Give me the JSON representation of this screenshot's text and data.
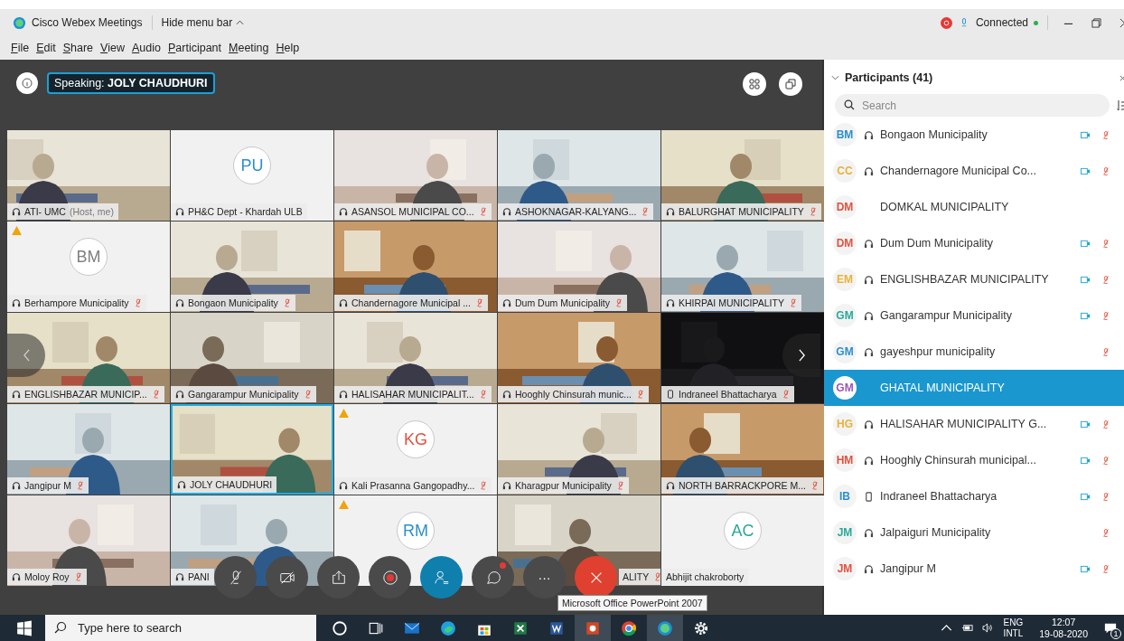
{
  "window": {
    "app_title": "Cisco Webex Meetings",
    "menu_toggle": "Hide menu bar",
    "status": "Connected"
  },
  "menu": [
    "File",
    "Edit",
    "Share",
    "View",
    "Audio",
    "Participant",
    "Meeting",
    "Help"
  ],
  "speaking": {
    "label": "Speaking:",
    "name": "JOLY CHAUDHURI"
  },
  "tiles": [
    {
      "kind": "video",
      "name": "ATI- UMC",
      "note": "(Host, me)",
      "audio": {
        "kind": "headset"
      },
      "muted": false,
      "warning": false,
      "active": false,
      "covered": false
    },
    {
      "kind": "avatar",
      "initials": "PU",
      "color": "#2a8fd0",
      "name": "PH&C Dept - Khardah ULB",
      "audio": {
        "kind": "headset"
      },
      "muted": false,
      "warning": false,
      "active": false,
      "covered": false
    },
    {
      "kind": "video",
      "name": "ASANSOL MUNICIPAL CO...",
      "audio": {
        "kind": "headset"
      },
      "muted": true,
      "warning": false,
      "active": false,
      "covered": false
    },
    {
      "kind": "video",
      "name": "ASHOKNAGAR-KALYANG...",
      "audio": {
        "kind": "headset"
      },
      "muted": true,
      "warning": false,
      "active": false,
      "covered": false
    },
    {
      "kind": "video",
      "name": "BALURGHAT MUNICIPALITY",
      "audio": {
        "kind": "headset"
      },
      "muted": true,
      "warning": false,
      "active": false,
      "covered": false
    },
    {
      "kind": "avatar",
      "initials": "BM",
      "color": "#808080",
      "name": "Berhampore Municipality",
      "audio": {
        "kind": "headset"
      },
      "muted": true,
      "warning": true,
      "active": false,
      "covered": false
    },
    {
      "kind": "video",
      "name": "Bongaon Municipality",
      "audio": {
        "kind": "headset"
      },
      "muted": true,
      "warning": false,
      "active": false,
      "covered": false
    },
    {
      "kind": "video",
      "name": "Chandernagore Municipal ...",
      "audio": {
        "kind": "headset"
      },
      "muted": true,
      "warning": false,
      "active": false,
      "covered": false
    },
    {
      "kind": "video",
      "name": "Dum Dum Municipality",
      "audio": {
        "kind": "headset"
      },
      "muted": true,
      "warning": false,
      "active": false,
      "covered": false
    },
    {
      "kind": "video",
      "name": "KHIRPAI MUNICIPALITY",
      "audio": {
        "kind": "headset"
      },
      "muted": true,
      "warning": false,
      "active": false,
      "covered": false
    },
    {
      "kind": "video",
      "name": "ENGLISHBAZAR MUNICIP...",
      "audio": {
        "kind": "headset"
      },
      "muted": true,
      "warning": false,
      "active": false,
      "covered": false
    },
    {
      "kind": "video",
      "name": "Gangarampur Municipality",
      "audio": {
        "kind": "headset"
      },
      "muted": true,
      "warning": false,
      "active": false,
      "covered": false
    },
    {
      "kind": "video",
      "name": "HALISAHAR MUNICIPALIT...",
      "audio": {
        "kind": "headset"
      },
      "muted": true,
      "warning": false,
      "active": false,
      "covered": false
    },
    {
      "kind": "video",
      "name": "Hooghly Chinsurah munic...",
      "audio": {
        "kind": "headset"
      },
      "muted": true,
      "warning": false,
      "active": false,
      "covered": false
    },
    {
      "kind": "dark",
      "name": "Indraneel Bhattacharya",
      "audio": {
        "kind": "phone"
      },
      "muted": true,
      "warning": false,
      "active": false,
      "covered": false
    },
    {
      "kind": "video",
      "name": "Jangipur M",
      "audio": {
        "kind": "headset"
      },
      "muted": true,
      "warning": false,
      "active": false,
      "covered": false
    },
    {
      "kind": "video",
      "name": "JOLY CHAUDHURI",
      "audio": {
        "kind": "headset"
      },
      "muted": false,
      "warning": false,
      "active": true,
      "covered": false
    },
    {
      "kind": "avatar",
      "initials": "KG",
      "color": "#e0523f",
      "name": "Kali Prasanna Gangopadhy...",
      "audio": {
        "kind": "headset"
      },
      "muted": true,
      "warning": true,
      "active": false,
      "covered": false
    },
    {
      "kind": "video",
      "name": "Kharagpur Municipality",
      "audio": {
        "kind": "headset"
      },
      "muted": true,
      "warning": false,
      "active": false,
      "covered": false
    },
    {
      "kind": "video",
      "name": "NORTH BARRACKPORE M...",
      "audio": {
        "kind": "headset"
      },
      "muted": true,
      "warning": false,
      "active": false,
      "covered": false
    },
    {
      "kind": "video",
      "name": "Moloy Roy",
      "audio": {
        "kind": "headset"
      },
      "muted": true,
      "warning": false,
      "active": false,
      "covered": false
    },
    {
      "kind": "video",
      "name": "PANI",
      "audio": {
        "kind": "headset"
      },
      "muted": false,
      "warning": false,
      "active": false,
      "covered": false
    },
    {
      "kind": "avatar",
      "initials": "RM",
      "color": "#2a8fd0",
      "warning": true,
      "active": false
    },
    {
      "kind": "video",
      "name": "ALITY",
      "muted": true,
      "warning": false,
      "active": false,
      "covered": true
    },
    {
      "kind": "avatar",
      "initials": "AC",
      "color": "#2aa89a",
      "name": "Abhijit chakroborty",
      "muted": false,
      "warning": false,
      "active": false,
      "covered": false
    }
  ],
  "controls": {
    "more": "···",
    "tooltip": "Microsoft Office PowerPoint 2007"
  },
  "participants": {
    "title": "Participants (41)",
    "search": {
      "placeholder": "Search"
    },
    "items": [
      {
        "initials": "BM",
        "color": "#2a8fd0",
        "name": "Bongaon Municipality",
        "audio": {
          "kind": "headset"
        },
        "video": true,
        "muted": true,
        "selected": false
      },
      {
        "initials": "CC",
        "color": "#e8b23a",
        "name": "Chandernagore Municipal Co...",
        "audio": {
          "kind": "headset"
        },
        "video": true,
        "muted": true,
        "selected": false
      },
      {
        "initials": "DM",
        "color": "#e0523f",
        "name": "DOMKAL MUNICIPALITY",
        "video": false,
        "muted": false,
        "selected": false
      },
      {
        "initials": "DM",
        "color": "#e0523f",
        "name": "Dum Dum Municipality",
        "audio": {
          "kind": "headset"
        },
        "video": true,
        "muted": true,
        "selected": false
      },
      {
        "initials": "EM",
        "color": "#e8b23a",
        "name": "ENGLISHBAZAR MUNICIPALITY",
        "audio": {
          "kind": "headset"
        },
        "video": true,
        "muted": true,
        "selected": false
      },
      {
        "initials": "GM",
        "color": "#2aa89a",
        "name": "Gangarampur Municipality",
        "audio": {
          "kind": "headset"
        },
        "video": true,
        "muted": true,
        "selected": false
      },
      {
        "initials": "GM",
        "color": "#2a8fd0",
        "name": "gayeshpur municipality",
        "audio": {
          "kind": "headset"
        },
        "video": false,
        "muted": true,
        "selected": false
      },
      {
        "initials": "GM",
        "color": "#9b59b6",
        "name": "GHATAL MUNICIPALITY",
        "video": false,
        "muted": false,
        "selected": true
      },
      {
        "initials": "HG",
        "color": "#e8b23a",
        "name": "HALISAHAR MUNICIPALITY G...",
        "audio": {
          "kind": "headset"
        },
        "video": true,
        "muted": true,
        "selected": false
      },
      {
        "initials": "HM",
        "color": "#e0523f",
        "name": "Hooghly Chinsurah municipal...",
        "audio": {
          "kind": "headset"
        },
        "video": true,
        "muted": true,
        "selected": false
      },
      {
        "initials": "IB",
        "color": "#2a8fd0",
        "name": "Indraneel Bhattacharya",
        "audio": {
          "kind": "phone"
        },
        "video": true,
        "muted": true,
        "selected": false
      },
      {
        "initials": "JM",
        "color": "#2aa89a",
        "name": "Jalpaiguri Municipality",
        "audio": {
          "kind": "headset"
        },
        "video": false,
        "muted": true,
        "selected": false
      },
      {
        "initials": "JM",
        "color": "#e0523f",
        "name": "Jangipur M",
        "audio": {
          "kind": "headset"
        },
        "video": true,
        "muted": true,
        "selected": false
      }
    ]
  },
  "taskbar": {
    "search_placeholder": "Type here to search",
    "lang_top": "ENG",
    "lang_bottom": "INTL",
    "time": "12:07",
    "date": "19-08-2020",
    "notifications": "1"
  }
}
